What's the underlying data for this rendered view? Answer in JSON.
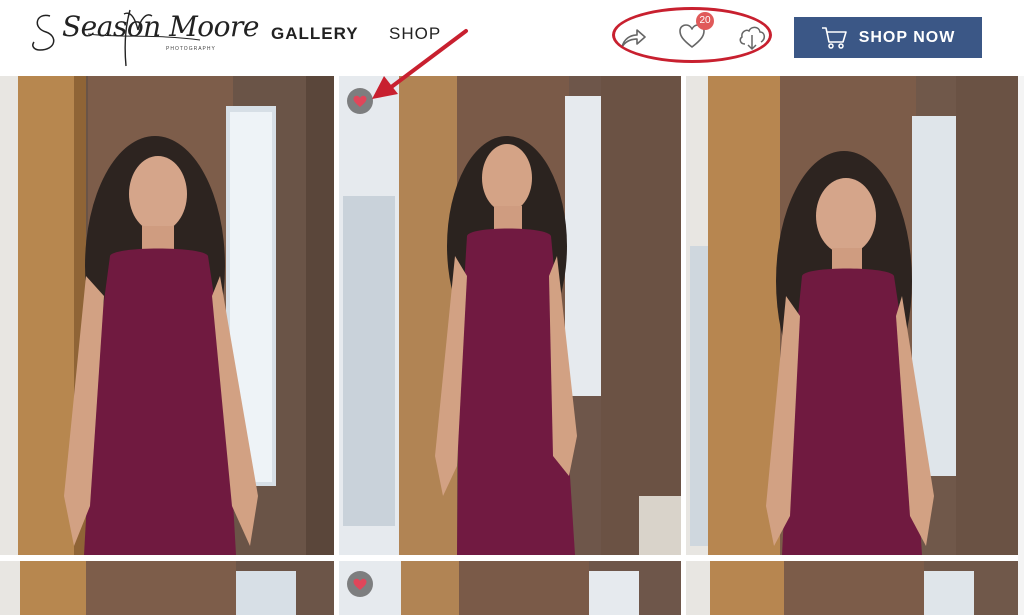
{
  "header": {
    "logo": {
      "name": "Season Moore",
      "tagline": "PHOTOGRAPHY"
    },
    "nav": {
      "gallery_label": "GALLERY",
      "shop_label": "SHOP"
    },
    "actions": {
      "share_icon": "share-arrow-icon",
      "favorites_icon": "heart-outline-icon",
      "favorites_count": "20",
      "download_icon": "cloud-download-icon"
    },
    "shop_now": {
      "label": "SHOP NOW",
      "icon": "shopping-cart-icon",
      "color": "#3b5786"
    }
  },
  "annotation": {
    "color": "#c8202f"
  },
  "gallery": {
    "photos": [
      {
        "favorited": false
      },
      {
        "favorited": true
      },
      {
        "favorited": false
      },
      {
        "favorited": false
      },
      {
        "favorited": true
      },
      {
        "favorited": false
      }
    ]
  }
}
